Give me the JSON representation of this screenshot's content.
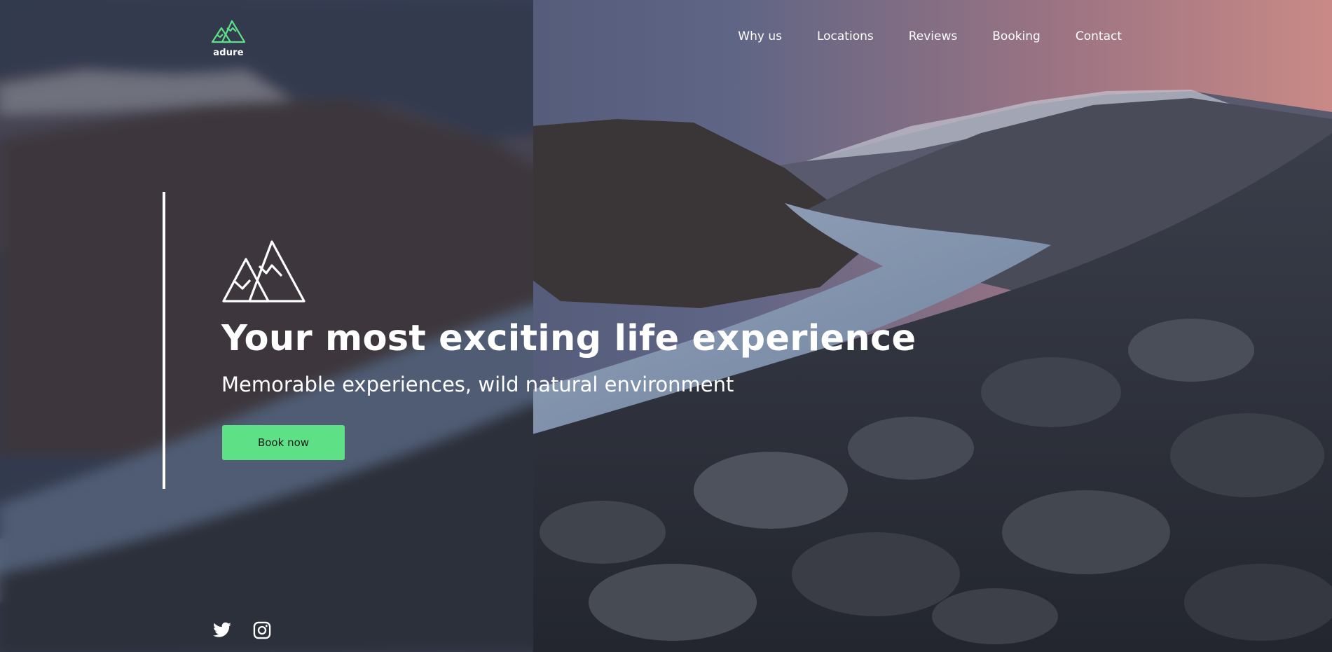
{
  "header": {
    "logo_text": "adure",
    "logo_icon": "mountain-logo-icon",
    "accent_color": "#5ee086"
  },
  "nav": {
    "items": [
      {
        "label": "Why us"
      },
      {
        "label": "Locations"
      },
      {
        "label": "Reviews"
      },
      {
        "label": "Booking"
      },
      {
        "label": "Contact"
      }
    ]
  },
  "hero": {
    "icon": "mountain-icon",
    "title": "Your most exciting life experience",
    "subtitle": "Memorable experiences, wild natural environment",
    "cta_label": "Book now",
    "cta_color": "#5ee086"
  },
  "social": {
    "items": [
      {
        "icon": "twitter-icon"
      },
      {
        "icon": "instagram-icon"
      }
    ]
  }
}
